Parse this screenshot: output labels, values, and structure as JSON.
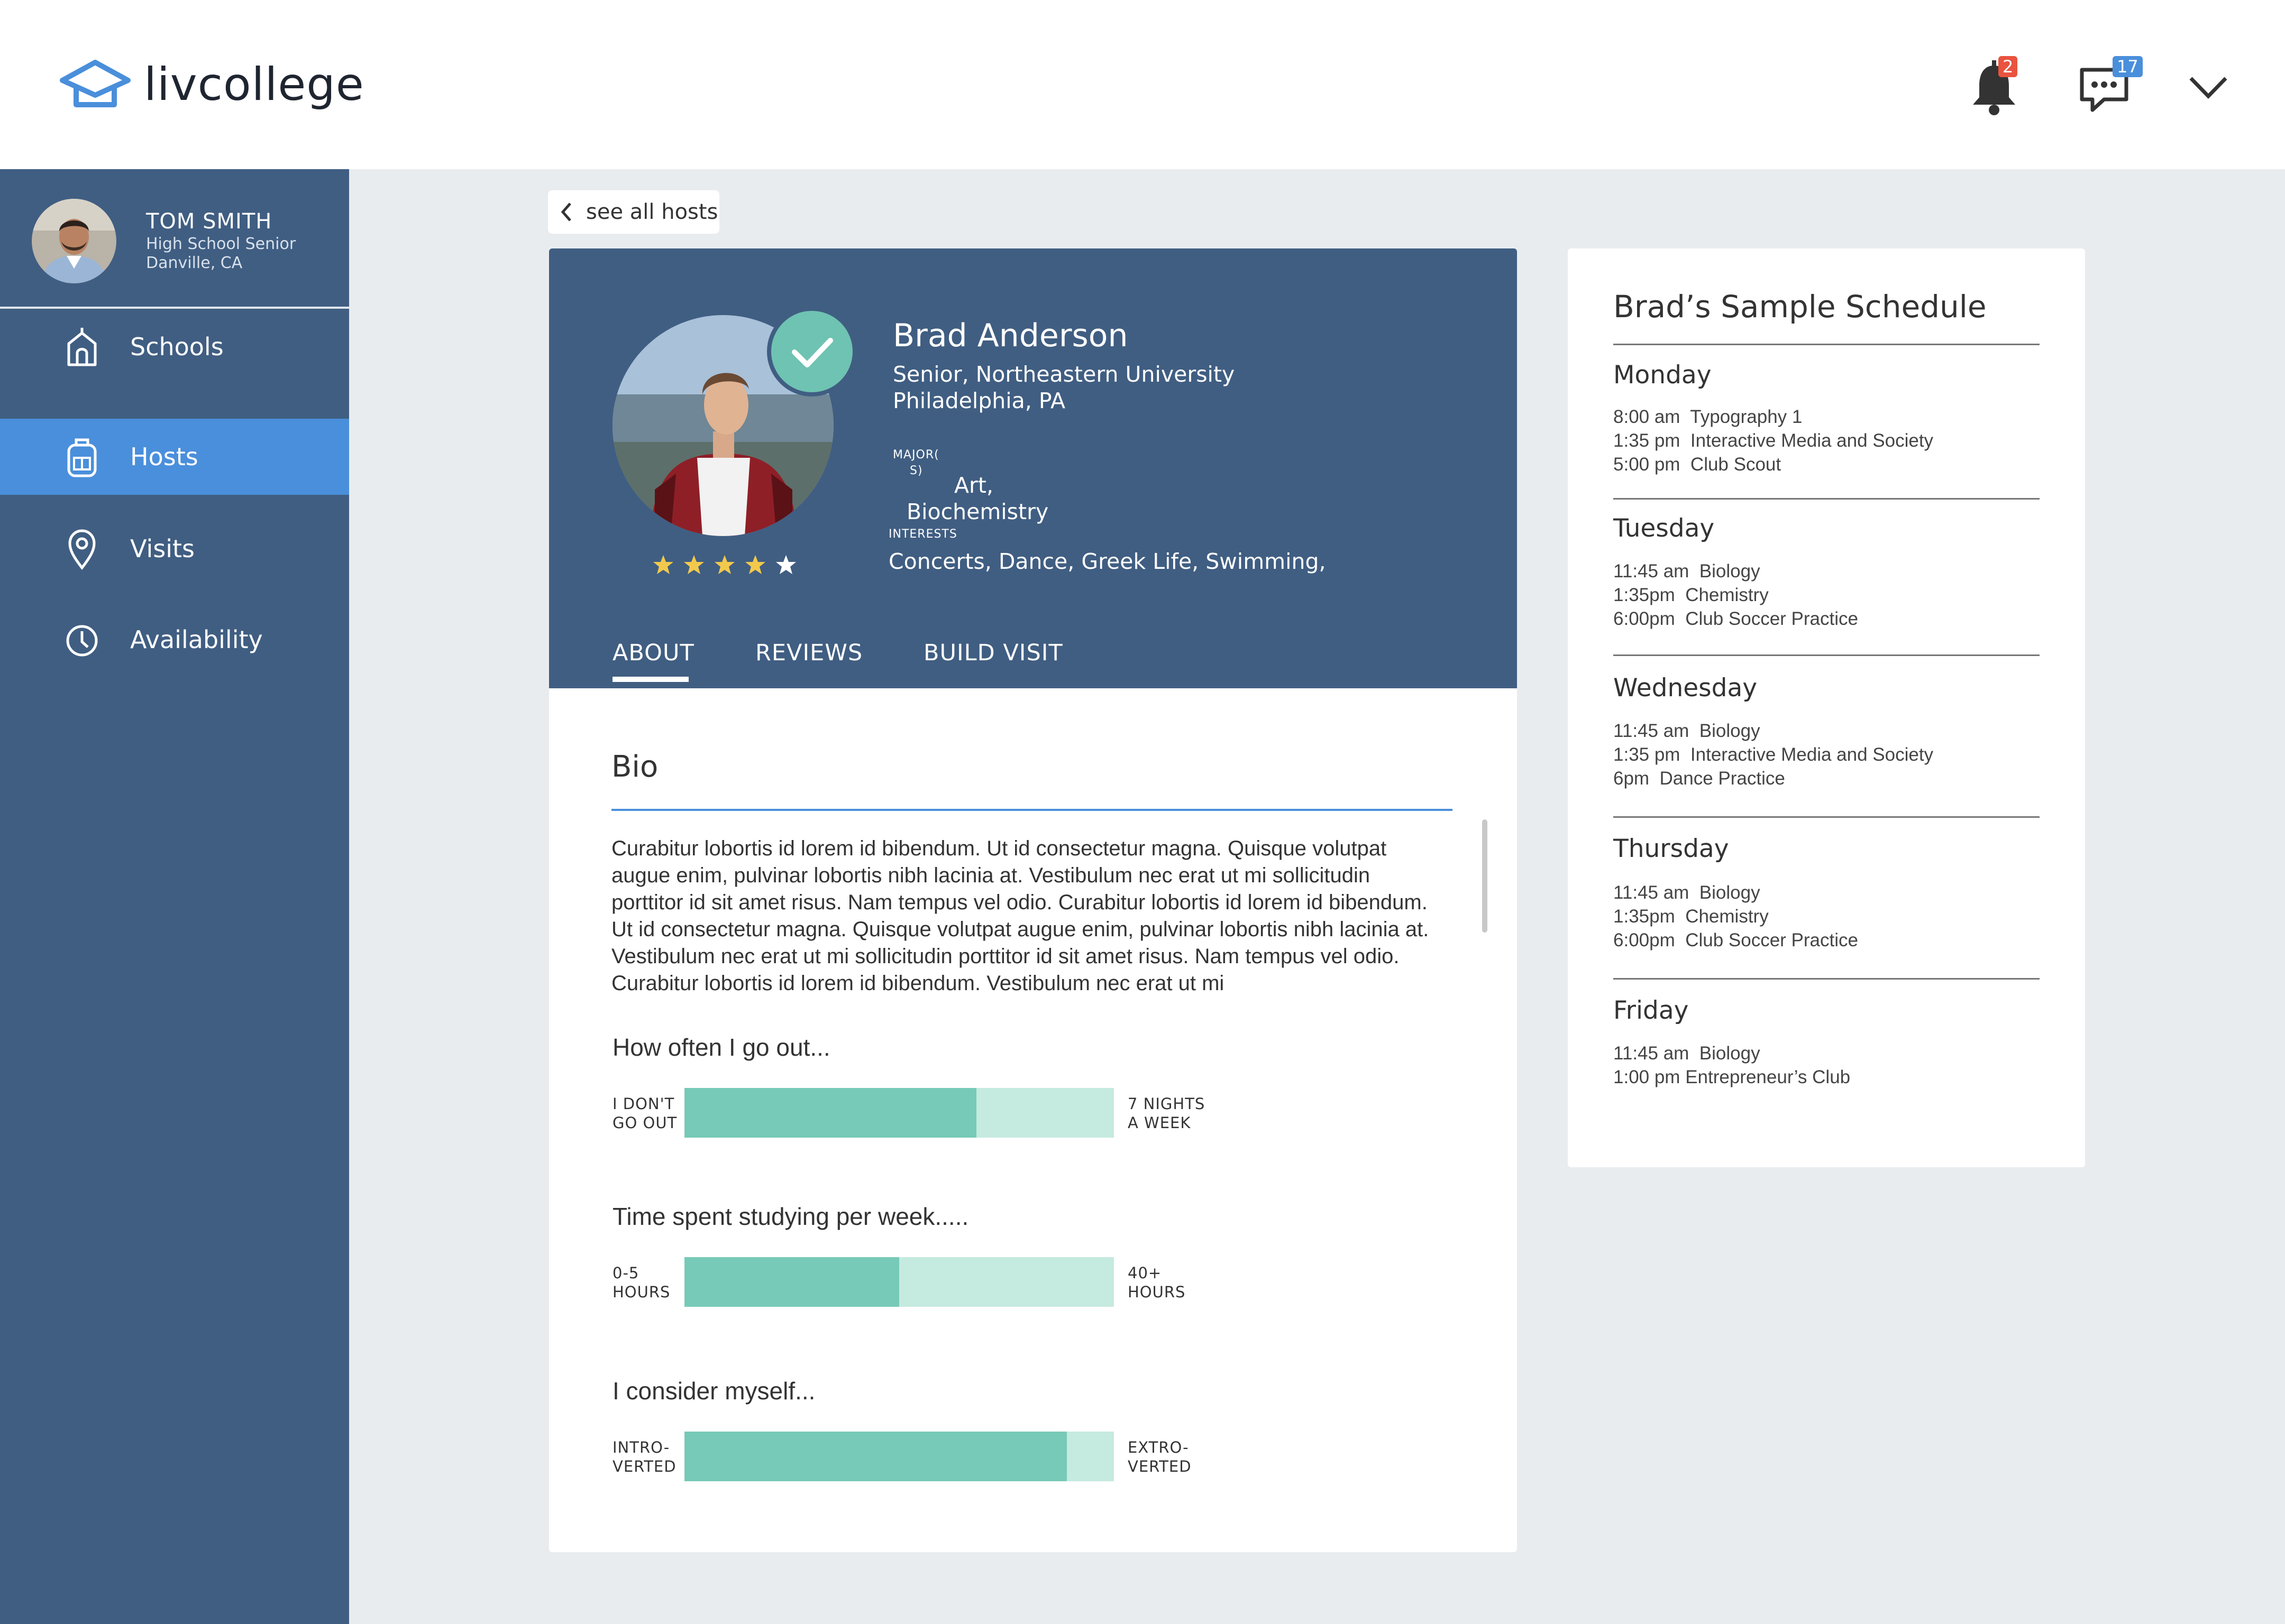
{
  "app": {
    "name": "livcollege",
    "notifications_count": "2",
    "messages_count": "17",
    "icons": [
      "house-cap-logo-icon",
      "bell-icon",
      "chat-icon",
      "chevron-down-icon"
    ]
  },
  "user": {
    "name": "TOM SMITH",
    "role": "High School Senior",
    "location": "Danville, CA"
  },
  "sidebar": {
    "items": [
      {
        "label": "Schools",
        "icon": "school-icon",
        "active": false
      },
      {
        "label": "Hosts",
        "icon": "backpack-icon",
        "active": true
      },
      {
        "label": "Visits",
        "icon": "location-pin-icon",
        "active": false
      },
      {
        "label": "Availability",
        "icon": "clock-icon",
        "active": false
      }
    ]
  },
  "back_link": {
    "label": "see all hosts"
  },
  "host": {
    "name": "Brad Anderson",
    "school_line": "Senior, Northeastern University",
    "location": "Philadelphia, PA",
    "majors_label_1": "MAJOR(",
    "majors_label_2": "S)",
    "majors_1": "Art,",
    "majors_2": "Biochemistry",
    "interests_label": "INTERESTS",
    "interests": "Concerts, Dance, Greek Life, Swimming,",
    "rating": 4,
    "rating_max": 5,
    "verified": true
  },
  "tabs": [
    {
      "label": "ABOUT",
      "active": true
    },
    {
      "label": "REVIEWS",
      "active": false
    },
    {
      "label": "BUILD VISIT",
      "active": false
    }
  ],
  "bio": {
    "title": "Bio",
    "text": "Curabitur lobortis id lorem id bibendum. Ut id consectetur magna. Quisque volutpat augue enim, pulvinar lobortis nibh lacinia at. Vestibulum nec erat ut mi sollicitudin porttitor id sit amet risus. Nam tempus vel odio. Curabitur lobortis id lorem id bibendum. Ut id consectetur magna. Quisque volutpat augue enim, pulvinar lobortis nibh lacinia at. Vestibulum nec erat ut mi sollicitudin porttitor id sit amet risus. Nam tempus vel odio. Curabitur lobortis id lorem id bibendum. Vestibulum nec erat ut mi"
  },
  "meters": [
    {
      "question": "How often I go out...",
      "left_1": "I DON'T",
      "left_2": "GO OUT",
      "right_1": "7 NIGHTS",
      "right_2": "A WEEK",
      "level": 0.68
    },
    {
      "question": "Time spent studying per week.....",
      "left_1": "0-5",
      "left_2": "HOURS",
      "right_1": "40+",
      "right_2": "HOURS",
      "level": 0.5
    },
    {
      "question": "I consider myself...",
      "left_1": "INTRO-",
      "left_2": "VERTED",
      "right_1": "EXTRO-",
      "right_2": "VERTED",
      "level": 0.89
    }
  ],
  "schedule": {
    "title": "Brad’s Sample Schedule",
    "days": [
      {
        "day": "Monday",
        "lines": "8:00 am  Typography 1\n1:35 pm  Interactive Media and Society\n5:00 pm  Club Scout"
      },
      {
        "day": "Tuesday",
        "lines": "11:45 am  Biology\n1:35pm  Chemistry\n6:00pm  Club Soccer Practice"
      },
      {
        "day": "Wednesday",
        "lines": "11:45 am  Biology\n1:35 pm  Interactive Media and Society\n6pm  Dance Practice"
      },
      {
        "day": "Thursday",
        "lines": "11:45 am  Biology\n1:35pm  Chemistry\n6:00pm  Club Soccer Practice"
      },
      {
        "day": "Friday",
        "lines": "11:45 am  Biology\n1:00 pm Entrepreneur’s Club"
      }
    ]
  },
  "colors": {
    "sidebar": "#405e82",
    "active_nav": "#4a8fdb",
    "meter_fill": "#77cab7",
    "meter_track": "#c5eadf",
    "verify": "#6fc3b2",
    "star": "#f2c94c"
  }
}
